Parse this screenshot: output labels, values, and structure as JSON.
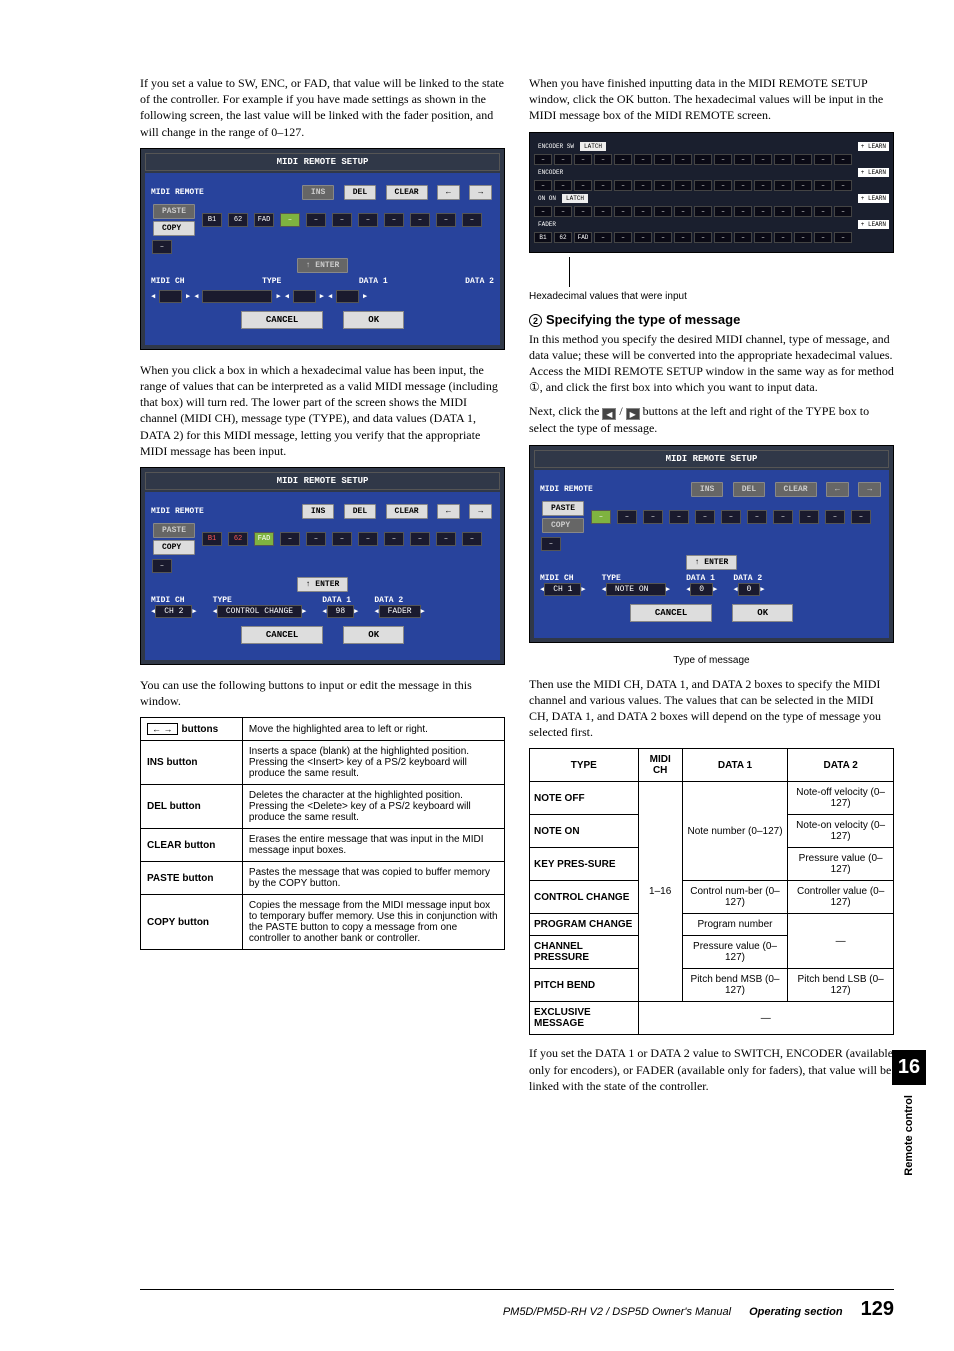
{
  "left": {
    "p1": "If you set a value to SW, ENC, or FAD, that value will be linked to the state of the controller. For example if you have made settings as shown in the following screen, the last value will be linked with the fader position, and will change in the range of 0–127.",
    "p2": "When you click a box in which a hexadecimal value has been input, the range of values that can be interpreted as a valid MIDI message (including that box) will turn red. The lower part of the screen shows the MIDI channel (MIDI CH), message type (TYPE), and data values (DATA 1, DATA 2) for this MIDI message, letting you verify that the appropriate MIDI message has been input.",
    "p3": "You can use the following buttons to input or edit the message in this window.",
    "ui1": {
      "title": "MIDI REMOTE SETUP",
      "lbl_remote": "MIDI REMOTE",
      "ins": "INS",
      "del": "DEL",
      "clear": "CLEAR",
      "paste": "PASTE",
      "copy": "COPY",
      "b1": "B1",
      "b2": "62",
      "b3": "FAD",
      "enter": "↑ ENTER",
      "midich": "MIDI CH",
      "type": "TYPE",
      "d1": "DATA 1",
      "d2": "DATA 2",
      "cancel": "CANCEL",
      "ok": "OK"
    },
    "ui2": {
      "title": "MIDI REMOTE SETUP",
      "lbl_remote": "MIDI REMOTE",
      "ins": "INS",
      "del": "DEL",
      "clear": "CLEAR",
      "paste": "PASTE",
      "copy": "COPY",
      "b1": "B1",
      "b2": "62",
      "b3": "FAD",
      "enter": "↑ ENTER",
      "midich_l": "MIDI CH",
      "midich_v": "CH 2",
      "type_l": "TYPE",
      "type_v": "CONTROL CHANGE",
      "d1_l": "DATA 1",
      "d1_v": "98",
      "d2_l": "DATA 2",
      "d2_v": "FADER",
      "cancel": "CANCEL",
      "ok": "OK"
    },
    "tbl": {
      "r0_l": "buttons",
      "r0_d": "Move the highlighted area to left or right.",
      "r1_l": "INS button",
      "r1_d": "Inserts a space (blank) at the highlighted position. Pressing the <Insert> key of a PS/2 keyboard will produce the same result.",
      "r2_l": "DEL button",
      "r2_d": "Deletes the character at the highlighted position. Pressing the <Delete> key of a PS/2 keyboard will produce the same result.",
      "r3_l": "CLEAR button",
      "r3_d": "Erases the entire message that was input in the MIDI message input boxes.",
      "r4_l": "PASTE button",
      "r4_d": "Pastes the message that was copied to buffer memory by the COPY button.",
      "r5_l": "COPY button",
      "r5_d": "Copies the message from the MIDI message input box to temporary buffer memory. Use this in conjunction with the PASTE button to copy a message from one controller to another bank or controller."
    }
  },
  "right": {
    "p1": "When you have finished inputting data in the MIDI REMOTE SETUP window, click the OK button. The hexadecimal values will be input in the MIDI message box of the MIDI REMOTE screen.",
    "cap1": "Hexadecimal values that were input",
    "h2": "Specifying the type of message",
    "p2": "In this method you specify the desired MIDI channel, type of message, and data value; these will be converted into the appropriate hexadecimal values. Access the MIDI REMOTE SETUP window in the same way as for method ①, and click the first box into which you want to input data.",
    "p3a": "Next, click the ",
    "p3b": " / ",
    "p3c": " buttons at the left and right of the TYPE box to select the type of message.",
    "ui3": {
      "title": "MIDI REMOTE SETUP",
      "lbl_remote": "MIDI REMOTE",
      "ins": "INS",
      "del": "DEL",
      "clear": "CLEAR",
      "paste": "PASTE",
      "copy": "COPY",
      "enter": "↑ ENTER",
      "midich_l": "MIDI CH",
      "midich_v": "CH 1",
      "type_l": "TYPE",
      "type_v": "NOTE ON",
      "d1_l": "DATA 1",
      "d1_v": "0",
      "d2_l": "DATA 2",
      "d2_v": "0",
      "cancel": "CANCEL",
      "ok": "OK"
    },
    "cap2": "Type of message",
    "p4": "Then use the MIDI CH, DATA 1, and DATA 2 boxes to specify the MIDI channel and various values. The values that can be selected in the MIDI CH, DATA 1, and DATA 2 boxes will depend on the type of message you selected first.",
    "tbl2": {
      "h_type": "TYPE",
      "h_ch": "MIDI CH",
      "h_d1": "DATA 1",
      "h_d2": "DATA 2",
      "r0_t": "NOTE OFF",
      "r0_d2": "Note-off velocity (0–127)",
      "r1_t": "NOTE ON",
      "r1_d1": "Note number (0–127)",
      "r1_d2": "Note-on velocity (0–127)",
      "r2_t": "KEY PRES-SURE",
      "r2_d2": "Pressure value (0–127)",
      "r3_t": "CONTROL CHANGE",
      "ch": "1–16",
      "r3_d1": "Control num-ber (0–127)",
      "r3_d2": "Controller value (0–127)",
      "r4_t": "PROGRAM CHANGE",
      "r4_d1": "Program number",
      "r5_t": "CHANNEL PRESSURE",
      "r5_d1": "Pressure value (0–127)",
      "dash": "—",
      "r6_t": "PITCH BEND",
      "r6_d1": "Pitch bend MSB (0–127)",
      "r6_d2": "Pitch bend LSB (0–127)",
      "r7_t": "EXCLUSIVE MESSAGE"
    },
    "p5": "If you set the DATA 1 or DATA 2 value to SWITCH, ENCODER (available only for encoders), or FADER (available only for faders), that value will be linked with the state of the controller.",
    "hex": {
      "sw": "ENCODER SW",
      "latch": "LATCH",
      "enc": "ENCODER",
      "on": "ON ON",
      "fad": "FADER",
      "learn": "+ LEARN",
      "b1": "B1",
      "b2": "62",
      "b3": "FAD"
    }
  },
  "side": {
    "chap": "16",
    "name": "Remote control"
  },
  "footer": {
    "manual": "PM5D/PM5D-RH V2 / DSP5D Owner's Manual",
    "section": "Operating section",
    "page": "129"
  }
}
